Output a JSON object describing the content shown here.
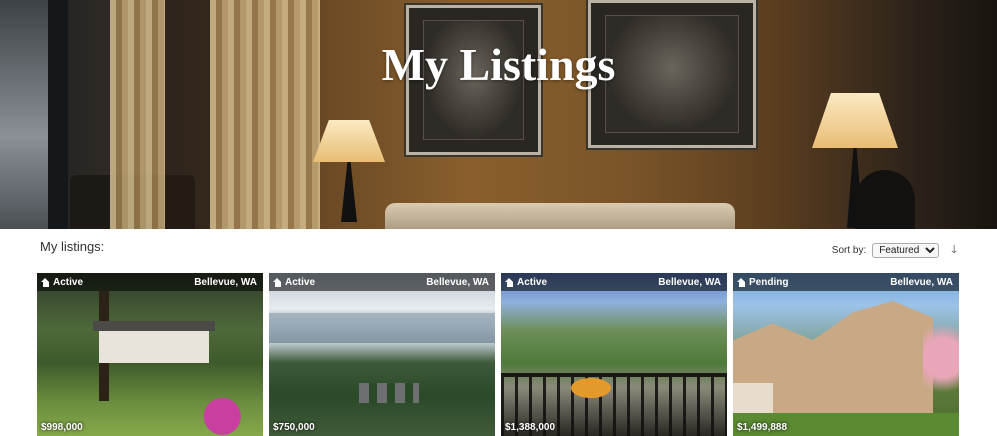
{
  "hero": {
    "title": "My Listings"
  },
  "toolbar": {
    "heading": "My listings:",
    "sort_label": "Sort by:",
    "sort_selected": "Featured",
    "sort_direction_icon": "arrow-down-icon"
  },
  "listings": [
    {
      "status": "Active",
      "location": "Bellevue, WA",
      "price": "$998,000"
    },
    {
      "status": "Active",
      "location": "Bellevue, WA",
      "price": "$750,000"
    },
    {
      "status": "Active",
      "location": "Bellevue, WA",
      "price": "$1,388,000"
    },
    {
      "status": "Pending",
      "location": "Bellevue, WA",
      "price": "$1,499,888"
    }
  ]
}
